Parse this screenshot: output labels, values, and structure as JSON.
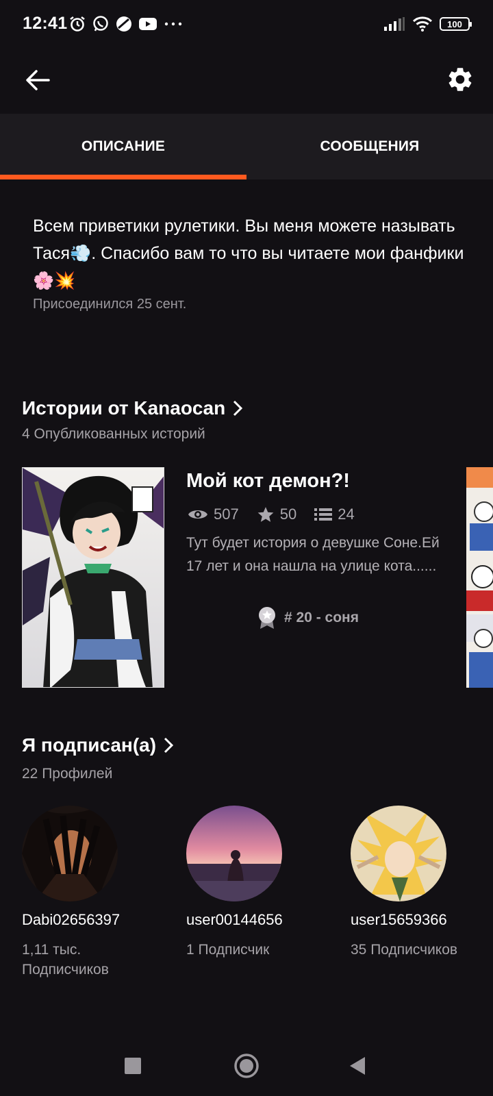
{
  "status_bar": {
    "time": "12:41",
    "left_icons": [
      "alarm-icon",
      "whatsapp-icon",
      "browser-icon",
      "youtube-icon",
      "more-dots-icon"
    ],
    "battery": "100"
  },
  "tabs": [
    {
      "label": "ОПИСАНИЕ",
      "active": true
    },
    {
      "label": "СООБЩЕНИЯ",
      "active": false
    }
  ],
  "accent_color": "#ff5a1f",
  "profile": {
    "description": "Всем приветики рулетики. Вы меня можете называть Тася💨. Спасибо вам то что вы читаете мои фанфики 🌸💥",
    "joined": "Присоединился 25 сент."
  },
  "stories": {
    "title": "Истории от Kanaocan",
    "subtitle": "4 Опубликованных историй",
    "items": [
      {
        "title": "Мой кот демон?!",
        "views": "507",
        "votes": "50",
        "parts": "24",
        "blurb": "Тут будет история о девушке Соне.Ей 17 лет и она нашла на улице кота......",
        "rank": "# 20 - соня"
      }
    ]
  },
  "following": {
    "title": "Я подписан(а)",
    "subtitle": "22 Профилей",
    "profiles": [
      {
        "name": "Dabi02656397",
        "followers": "1,11 тыс. Подписчиков"
      },
      {
        "name": "user00144656",
        "followers": "1 Подписчик"
      },
      {
        "name": "user15659366",
        "followers": "35 Подписчиков"
      }
    ]
  }
}
